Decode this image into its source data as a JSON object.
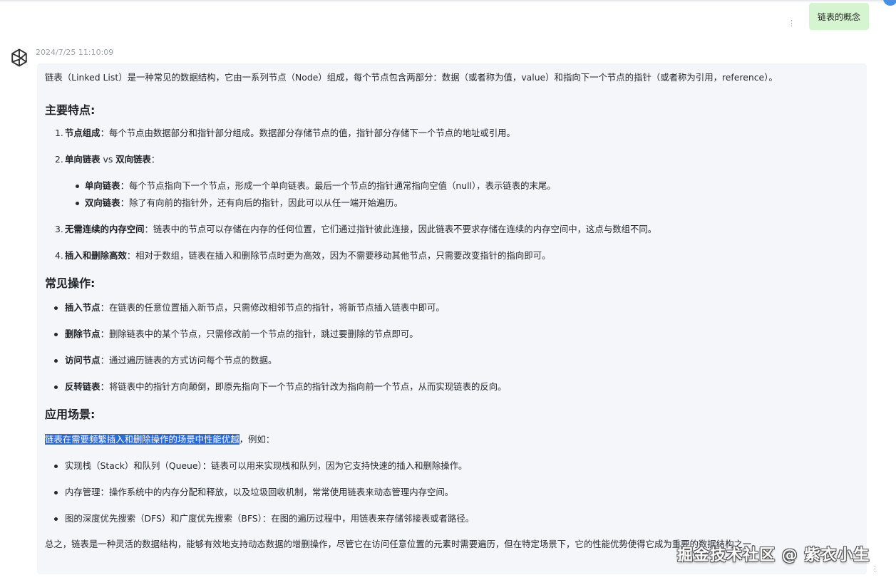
{
  "user_message": {
    "text": "链表的概念",
    "more_icon": "vertical-dots-icon"
  },
  "assistant": {
    "avatar_icon": "openai-logo-icon",
    "timestamp": "2024/7/25 11:10:09",
    "intro": "链表（Linked List）是一种常见的数据结构，它由一系列节点（Node）组成，每个节点包含两部分：数据（或者称为值，value）和指向下一个节点的指针（或者称为引用，reference）。",
    "features": {
      "heading": "主要特点:",
      "items": [
        {
          "num": "1.",
          "term": "节点组成",
          "text": "：每个节点由数据部分和指针部分组成。数据部分存储节点的值，指针部分存储下一个节点的地址或引用。"
        },
        {
          "num": "2.",
          "term": "单向链表",
          "mid": " vs ",
          "term2": "双向链表",
          "text": "："
        },
        {
          "num": "3.",
          "term": "无需连续的内存空间",
          "text": "：链表中的节点可以存储在内存的任何位置，它们通过指针彼此连接，因此链表不要求存储在连续的内存空间中，这点与数组不同。"
        },
        {
          "num": "4.",
          "term": "插入和删除高效",
          "text": "：相对于数组，链表在插入和删除节点时更为高效，因为不需要移动其他节点，只需要改变指针的指向即可。"
        }
      ],
      "sub_items": [
        {
          "term": "单向链表",
          "text": "：每个节点指向下一个节点，形成一个单向链表。最后一个节点的指针通常指向空值（null），表示链表的末尾。"
        },
        {
          "term": "双向链表",
          "text": "：除了有向前的指针外，还有向后的指针，因此可以从任一端开始遍历。"
        }
      ]
    },
    "operations": {
      "heading": "常见操作:",
      "items": [
        {
          "term": "插入节点",
          "text": "：在链表的任意位置插入新节点，只需修改相邻节点的指针，将新节点插入链表中即可。"
        },
        {
          "term": "删除节点",
          "text": "：删除链表中的某个节点，只需修改前一个节点的指针，跳过要删除的节点即可。"
        },
        {
          "term": "访问节点",
          "text": "：通过遍历链表的方式访问每个节点的数据。"
        },
        {
          "term": "反转链表",
          "text": "：将链表中的指针方向颠倒，即原先指向下一个节点的指针改为指向前一个节点，从而实现链表的反向。"
        }
      ]
    },
    "applications": {
      "heading": "应用场景:",
      "highlighted": "链表在需要频繁插入和删除操作的场景中性能优越",
      "after_highlight": "，例如：",
      "items": [
        "实现栈（Stack）和队列（Queue）：链表可以用来实现栈和队列，因为它支持快速的插入和删除操作。",
        "内存管理：操作系统中的内存分配和释放，以及垃圾回收机制，常常使用链表来动态管理内存空间。",
        "图的深度优先搜索（DFS）和广度优先搜索（BFS）：在图的遍历过程中，用链表来存储邻接表或者路径。"
      ]
    },
    "summary": "总之，链表是一种灵活的数据结构，能够有效地支持动态数据的增删操作，尽管它在访问任意位置的元素时需要遍历，但在特定场景下，它的性能优势使得它成为重要的数据结构之一。",
    "more_icon": "vertical-dots-icon"
  },
  "watermark": "掘金技术社区 @ 紫衣小生",
  "colors": {
    "user_bubble": "#d5f4d0",
    "answer_bg": "#f4f6f9",
    "highlight": "#2f6ad0"
  }
}
